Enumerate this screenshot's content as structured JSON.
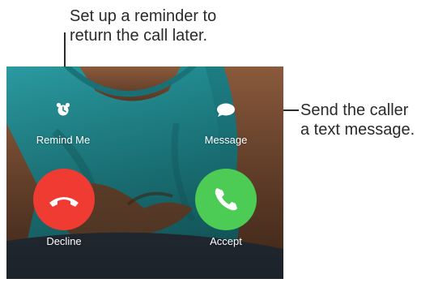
{
  "callouts": {
    "reminder_line1": "Set up a reminder to",
    "reminder_line2": "return the call later.",
    "message_line1": "Send the caller",
    "message_line2": "a text message."
  },
  "actions": {
    "remind_me": "Remind Me",
    "message": "Message",
    "decline": "Decline",
    "accept": "Accept"
  },
  "colors": {
    "decline": "#f03b32",
    "accept": "#4ccb55",
    "shirt": "#1f8a8f"
  },
  "icons": {
    "remind": "alarm-clock-icon",
    "message": "speech-bubble-icon",
    "decline": "phone-hangup-icon",
    "accept": "phone-icon"
  }
}
